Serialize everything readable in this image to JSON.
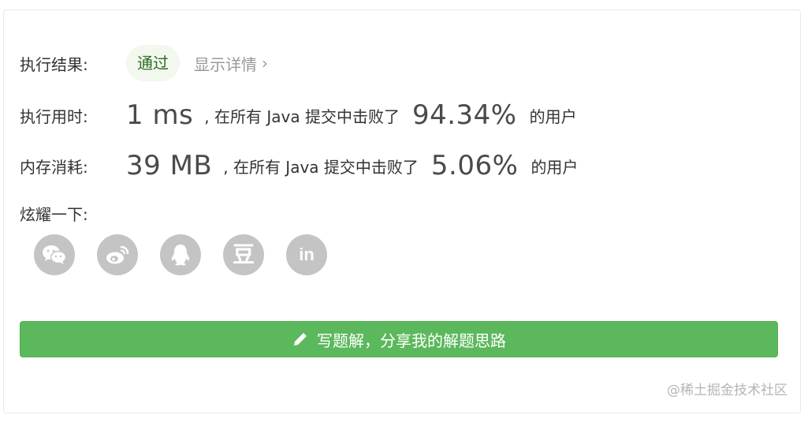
{
  "result": {
    "label": "执行结果:",
    "status": "通过",
    "detail_link": "显示详情",
    "detail_chevron": "›"
  },
  "runtime": {
    "label": "执行用时:",
    "value": "1 ms",
    "middle_text": ", 在所有 Java 提交中击败了",
    "percent": "94.34%",
    "tail_text": "的用户"
  },
  "memory": {
    "label": "内存消耗:",
    "value": "39 MB",
    "middle_text": ", 在所有 Java 提交中击败了",
    "percent": "5.06%",
    "tail_text": "的用户"
  },
  "share": {
    "label": "炫耀一下:",
    "icons": [
      "wechat-icon",
      "weibo-icon",
      "qq-icon",
      "douban-icon",
      "linkedin-icon"
    ],
    "douban_glyph": "豆",
    "linkedin_glyph": "in"
  },
  "solution_button": {
    "label": "写题解，分享我的解题思路",
    "icon": "pencil-icon"
  },
  "watermark": "@稀土掘金技术社区",
  "colors": {
    "button_green": "#5cb85c",
    "badge_bg": "#f3f8ef",
    "badge_text": "#2b6b1f",
    "icon_gray": "#c4c4c4"
  }
}
